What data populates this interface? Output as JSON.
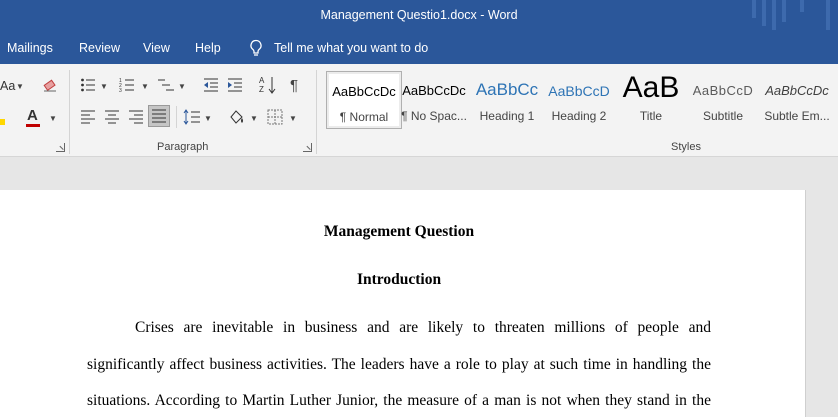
{
  "window": {
    "title": "Management Questio1.docx  -  Word"
  },
  "ribbon_tabs": [
    "Mailings",
    "Review",
    "View",
    "Help"
  ],
  "tell_me": {
    "placeholder": "Tell me what you want to do",
    "icon": "lightbulb-icon"
  },
  "font_group": {
    "change_case_label": "Aa",
    "font_color": "#c00000",
    "highlight_color": "#ffd700"
  },
  "paragraph": {
    "group_label": "Paragraph"
  },
  "styles": {
    "group_label": "Styles",
    "items": [
      {
        "preview": "AaBbCcDc",
        "name": "¶ Normal",
        "selected": true
      },
      {
        "preview": "AaBbCcDc",
        "name": "¶ No Spac..."
      },
      {
        "preview": "AaBbCc",
        "name": "Heading 1",
        "color": "#2e74b5"
      },
      {
        "preview": "AaBbCcD",
        "name": "Heading 2",
        "color": "#2e74b5"
      },
      {
        "preview": "AaB",
        "name": "Title"
      },
      {
        "preview": "AaBbCcD",
        "name": "Subtitle",
        "color": "#5a5a5a"
      },
      {
        "preview": "AaBbCcDc",
        "name": "Subtle Em...",
        "color": "#404040"
      }
    ]
  },
  "document": {
    "title": "Management Question",
    "section_heading": "Introduction",
    "lines": [
      "Crises are inevitable in business and are likely to threaten millions of people and",
      "significantly affect business activities. The leaders have a role to play at such time in handling the",
      "situations. According to Martin Luther Junior, the measure of a man is not when they stand in the"
    ]
  }
}
